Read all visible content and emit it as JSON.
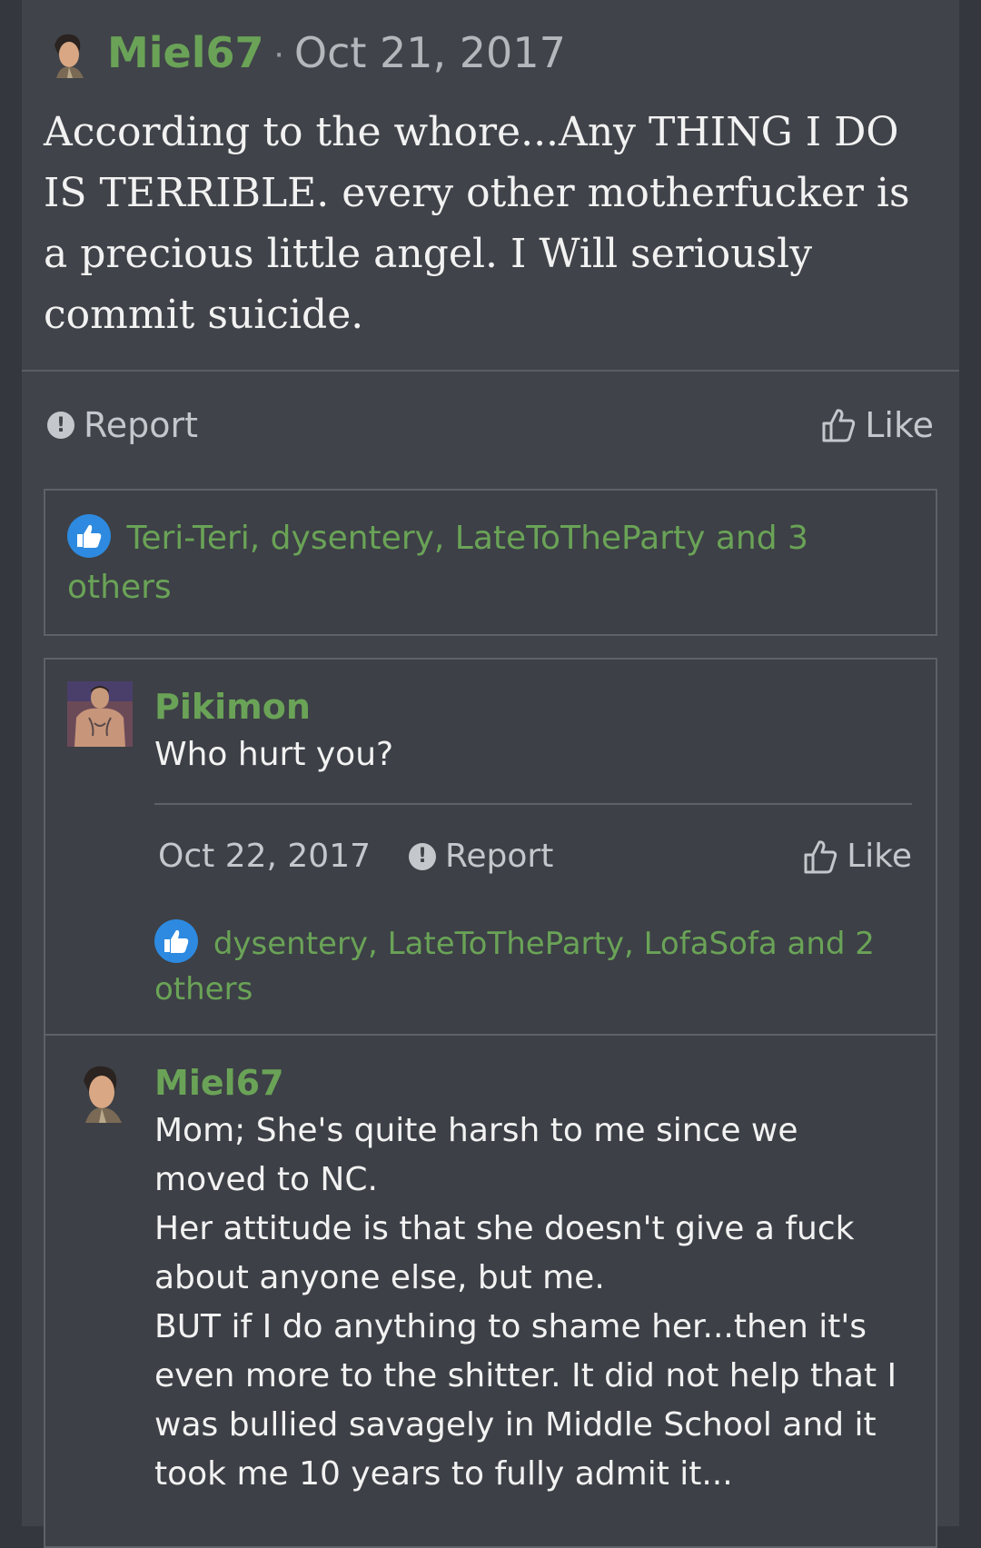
{
  "post": {
    "author": "Miel67",
    "separator": "·",
    "date": "Oct 21, 2017",
    "body": "According to the whore...Any THING I DO IS TERRIBLE. every other motherfucker is a precious little angel. I Will seriously commit suicide.",
    "report_label": "Report",
    "like_label": "Like",
    "reactions_text": "Teri-Teri, dysentery, LateToTheParty and 3 others"
  },
  "comments": [
    {
      "author": "Pikimon",
      "text": "Who hurt you?",
      "date": "Oct 22, 2017",
      "report_label": "Report",
      "like_label": "Like",
      "reactions_text": "dysentery, LateToTheParty, LofaSofa and 2 others"
    },
    {
      "author": "Miel67",
      "lines": [
        "Mom; She's quite harsh to me since we moved to NC.",
        "Her attitude is that she doesn't give a fuck about anyone else, but me.",
        "BUT if I do anything to shame her...then it's even more to the shitter. It did not help that I was bullied savagely in Middle School and it took me 10 years to fully admit it..."
      ]
    }
  ],
  "colors": {
    "accent_green": "#6aa357",
    "background": "#404349",
    "reaction_blue": "#2d8ae0"
  },
  "icons": {
    "report": "exclamation-circle-icon",
    "like": "thumbs-up-outline-icon",
    "reaction": "thumbs-up-badge-icon"
  }
}
